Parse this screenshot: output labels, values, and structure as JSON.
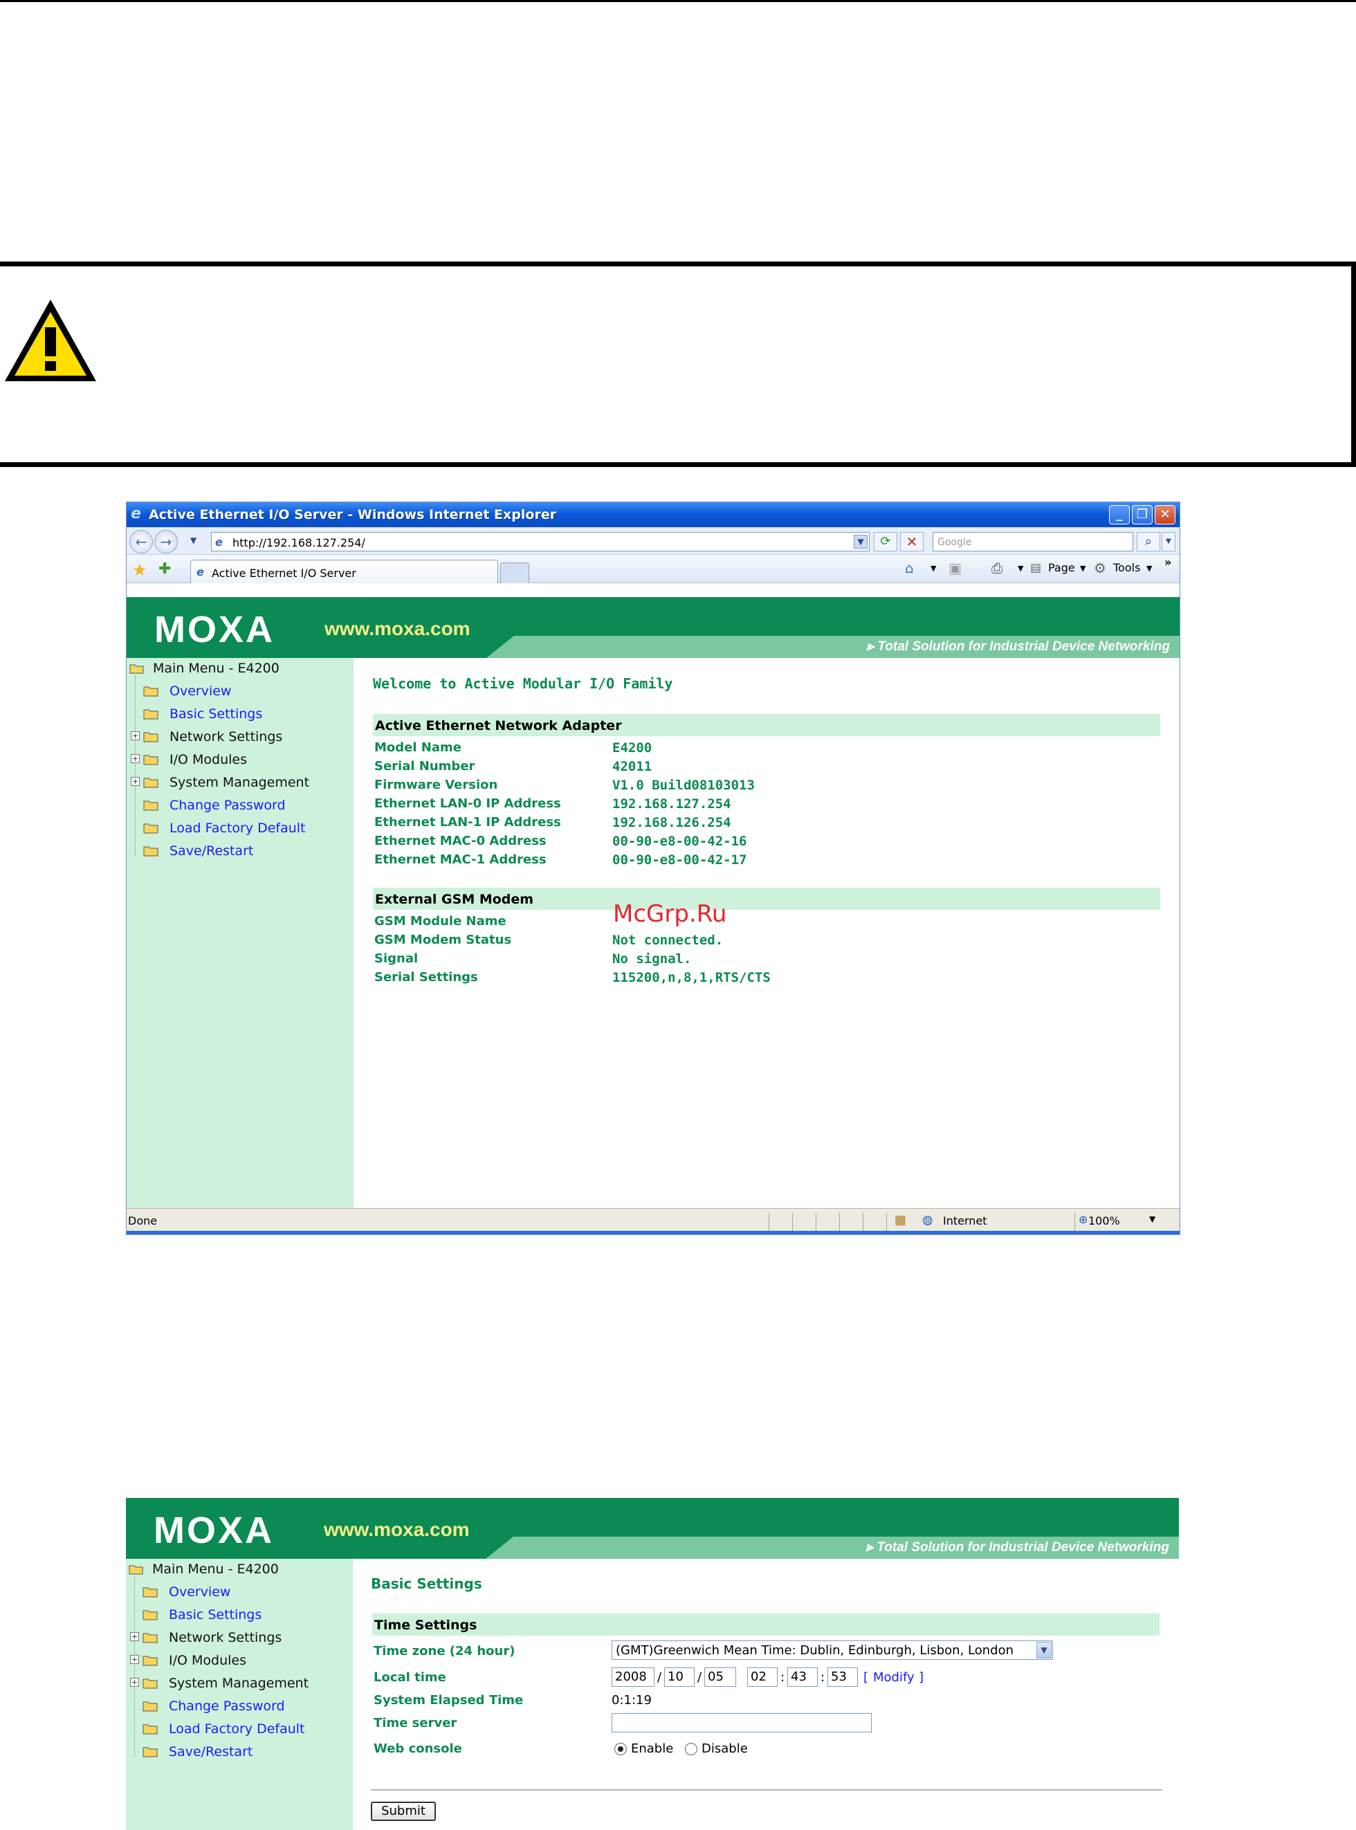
{
  "browser": {
    "window_title": "Active Ethernet I/O Server - Windows Internet Explorer",
    "address_url": "http://192.168.127.254/",
    "search_placeholder": "Google",
    "tab_label": "Active Ethernet I/O Server",
    "toolbar": {
      "page_label": "Page",
      "tools_label": "Tools",
      "more": "»"
    },
    "status": {
      "text": "Done",
      "zone": "Internet",
      "zoom": "100%"
    }
  },
  "moxa": {
    "logo": "MOXA",
    "url": "www.moxa.com",
    "tagline": "Total Solution for Industrial Device Networking"
  },
  "menu": {
    "root": "Main Menu - E4200",
    "items": [
      {
        "label": "Overview",
        "expandable": false,
        "link": true
      },
      {
        "label": "Basic Settings",
        "expandable": false,
        "link": true
      },
      {
        "label": "Network Settings",
        "expandable": true,
        "link": false
      },
      {
        "label": "I/O Modules",
        "expandable": true,
        "link": false
      },
      {
        "label": "System Management",
        "expandable": true,
        "link": false
      },
      {
        "label": "Change Password",
        "expandable": false,
        "link": true
      },
      {
        "label": "Load Factory Default",
        "expandable": false,
        "link": true
      },
      {
        "label": "Save/Restart",
        "expandable": false,
        "link": true
      }
    ]
  },
  "overview": {
    "welcome": "Welcome to Active Modular I/O Family",
    "adapter_section": "Active Ethernet Network Adapter",
    "adapter_rows": [
      {
        "key": "Model Name",
        "value": "E4200"
      },
      {
        "key": "Serial Number",
        "value": "42011"
      },
      {
        "key": "Firmware Version",
        "value": "V1.0 Build08103013"
      },
      {
        "key": "Ethernet LAN-0 IP Address",
        "value": "192.168.127.254"
      },
      {
        "key": "Ethernet LAN-1 IP Address",
        "value": "192.168.126.254"
      },
      {
        "key": "Ethernet MAC-0 Address",
        "value": "00-90-e8-00-42-16"
      },
      {
        "key": "Ethernet MAC-1 Address",
        "value": "00-90-e8-00-42-17"
      }
    ],
    "gsm_section": "External GSM Modem",
    "gsm_rows": [
      {
        "key": "GSM Module Name",
        "value": ""
      },
      {
        "key": "GSM Modem Status",
        "value": "Not connected."
      },
      {
        "key": "Signal",
        "value": "No signal."
      },
      {
        "key": "Serial Settings",
        "value": "115200,n,8,1,RTS/CTS"
      }
    ],
    "watermark": "McGrp.Ru"
  },
  "basic_settings": {
    "title": "Basic Settings",
    "section": "Time Settings",
    "timezone_label": "Time zone (24 hour)",
    "timezone_value": "(GMT)Greenwich Mean Time: Dublin, Edinburgh, Lisbon, London",
    "local_time_label": "Local time",
    "year": "2008",
    "month": "10",
    "day": "05",
    "hour": "02",
    "minute": "43",
    "second": "53",
    "date_sep": "/",
    "time_sep": ":",
    "bracket_open": "[",
    "modify": "Modify",
    "bracket_close": "]",
    "elapsed_label": "System Elapsed Time",
    "elapsed_value": "0:1:19",
    "time_server_label": "Time server",
    "time_server_value": "",
    "web_console_label": "Web console",
    "enable_label": "Enable",
    "disable_label": "Disable",
    "web_console_selected": "Enable",
    "submit_label": "Submit"
  },
  "colors": {
    "moxa_green": "#0b8a53",
    "menu_bg": "#cdf1db",
    "link_blue": "#1a1aff",
    "warning_yellow": "#ffde00"
  }
}
